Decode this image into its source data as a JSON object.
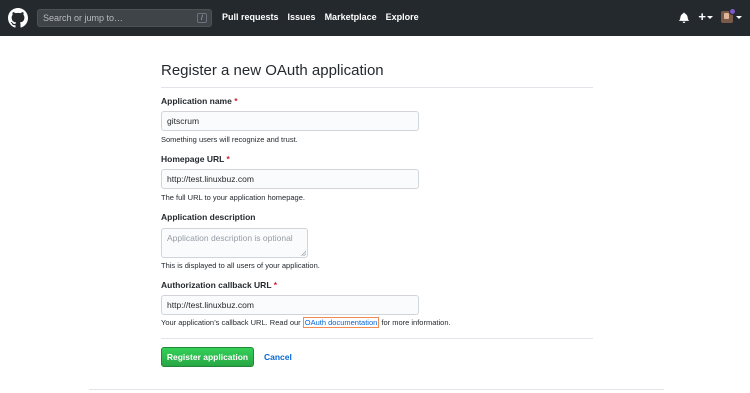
{
  "header": {
    "search_placeholder": "Search or jump to…",
    "search_shortcut": "/",
    "nav": [
      "Pull requests",
      "Issues",
      "Marketplace",
      "Explore"
    ],
    "plus_label": "+"
  },
  "page": {
    "title": "Register a new OAuth application"
  },
  "form": {
    "app_name": {
      "label": "Application name",
      "required_mark": "*",
      "value": "gitscrum",
      "note": "Something users will recognize and trust."
    },
    "homepage": {
      "label": "Homepage URL",
      "required_mark": "*",
      "value": "http://test.linuxbuz.com",
      "note": "The full URL to your application homepage."
    },
    "description": {
      "label": "Application description",
      "placeholder": "Application description is optional",
      "note": "This is displayed to all users of your application."
    },
    "callback": {
      "label": "Authorization callback URL",
      "required_mark": "*",
      "value": "http://test.linuxbuz.com",
      "note_before": "Your application’s callback URL. Read our ",
      "note_link": "OAuth documentation",
      "note_after": " for more information."
    }
  },
  "actions": {
    "register_label": "Register application",
    "cancel_label": "Cancel"
  },
  "colors": {
    "header_bg": "#24292e",
    "primary_green": "#28a745",
    "link_blue": "#0366d6",
    "required_red": "#cb2431"
  }
}
